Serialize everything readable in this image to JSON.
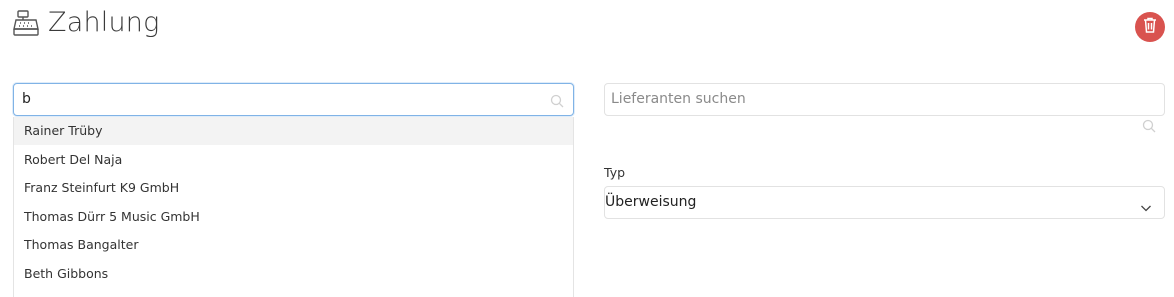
{
  "header": {
    "title": "Zahlung",
    "title_icon": "cash-register-icon",
    "delete_icon": "trash-icon",
    "delete_color": "#d9534f"
  },
  "customer_search": {
    "value": "b",
    "icon": "search-icon",
    "results": [
      {
        "label": "Rainer Trüby",
        "highlighted": true
      },
      {
        "label": "Robert Del Naja",
        "highlighted": false
      },
      {
        "label": "Franz Steinfurt K9 GmbH",
        "highlighted": false
      },
      {
        "label": "Thomas Dürr 5 Music GmbH",
        "highlighted": false
      },
      {
        "label": "Thomas Bangalter",
        "highlighted": false
      },
      {
        "label": "Beth Gibbons",
        "highlighted": false
      }
    ]
  },
  "supplier_search": {
    "placeholder": "Lieferanten suchen",
    "icon": "search-icon"
  },
  "type_field": {
    "label": "Typ",
    "value": "Überweisung",
    "icon": "chevron-down-icon"
  },
  "colors": {
    "focus_border": "#80b3e6",
    "highlight_row": "#f3f3f3"
  }
}
